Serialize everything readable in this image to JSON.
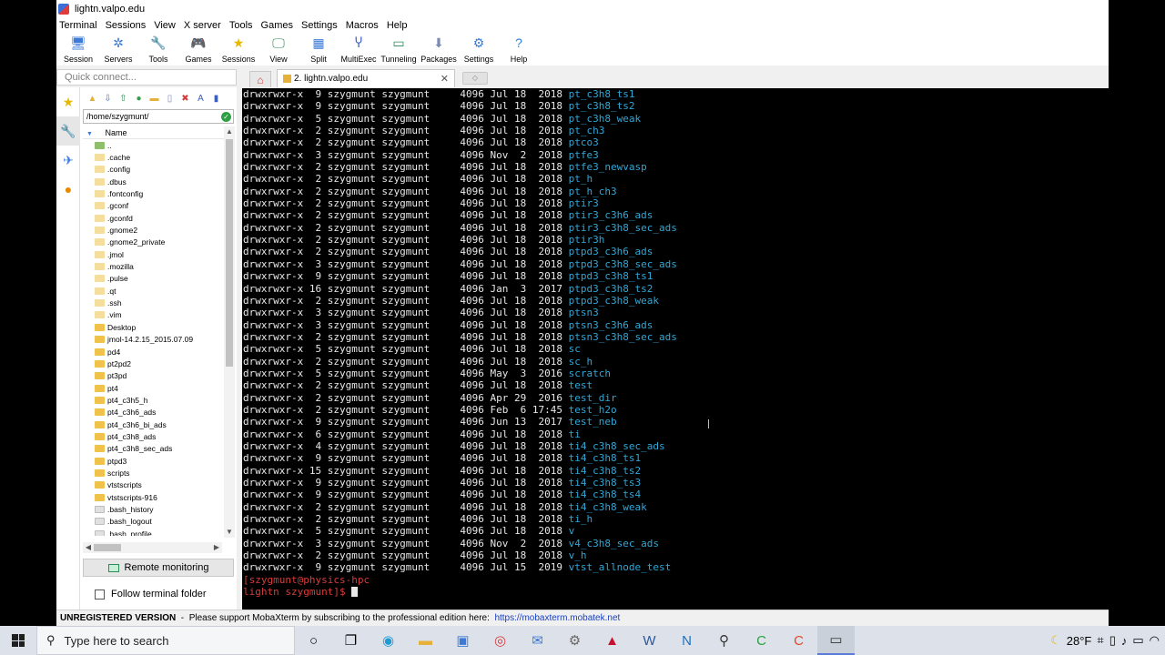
{
  "window": {
    "title": "lightn.valpo.edu"
  },
  "menu": [
    "Terminal",
    "Sessions",
    "View",
    "X server",
    "Tools",
    "Games",
    "Settings",
    "Macros",
    "Help"
  ],
  "toolbar": [
    {
      "label": "Session",
      "icon": "session-icon",
      "glyph": "🖥",
      "color": "#3b7ad8"
    },
    {
      "label": "Servers",
      "icon": "servers-icon",
      "glyph": "✲",
      "color": "#3b7ad8"
    },
    {
      "label": "Tools",
      "icon": "tools-icon",
      "glyph": "🔧",
      "color": "#d83b3b"
    },
    {
      "label": "Games",
      "icon": "games-icon",
      "glyph": "🎮",
      "color": "#555555"
    },
    {
      "label": "Sessions",
      "icon": "star-icon",
      "glyph": "★",
      "color": "#e6b800"
    },
    {
      "label": "View",
      "icon": "view-icon",
      "glyph": "🖵",
      "color": "#2e8b57"
    },
    {
      "label": "Split",
      "icon": "split-icon",
      "glyph": "▦",
      "color": "#3b7ad8"
    },
    {
      "label": "MultiExec",
      "icon": "multiexec-icon",
      "glyph": "Ⴤ",
      "color": "#3b5fbf"
    },
    {
      "label": "Tunneling",
      "icon": "tunneling-icon",
      "glyph": "▭",
      "color": "#2e8b57"
    },
    {
      "label": "Packages",
      "icon": "packages-icon",
      "glyph": "⬇",
      "color": "#7a8ab0"
    },
    {
      "label": "Settings",
      "icon": "gear-icon",
      "glyph": "⚙",
      "color": "#3b7ad8"
    },
    {
      "label": "Help",
      "icon": "help-icon",
      "glyph": "?",
      "color": "#2a7de1"
    }
  ],
  "quick_connect": {
    "placeholder": "Quick connect..."
  },
  "tabs": {
    "session_label": "2. lightn.valpo.edu"
  },
  "panel": {
    "path": "/home/szygmunt/",
    "column_header": "Name",
    "entries": [
      {
        "name": "..",
        "kind": "up"
      },
      {
        "name": ".cache",
        "kind": "hidden"
      },
      {
        "name": ".config",
        "kind": "hidden"
      },
      {
        "name": ".dbus",
        "kind": "hidden"
      },
      {
        "name": ".fontconfig",
        "kind": "hidden"
      },
      {
        "name": ".gconf",
        "kind": "hidden"
      },
      {
        "name": ".gconfd",
        "kind": "hidden"
      },
      {
        "name": ".gnome2",
        "kind": "hidden"
      },
      {
        "name": ".gnome2_private",
        "kind": "hidden"
      },
      {
        "name": ".jmol",
        "kind": "hidden"
      },
      {
        "name": ".mozilla",
        "kind": "hidden"
      },
      {
        "name": ".pulse",
        "kind": "hidden"
      },
      {
        "name": ".qt",
        "kind": "hidden"
      },
      {
        "name": ".ssh",
        "kind": "hidden"
      },
      {
        "name": ".vim",
        "kind": "hidden"
      },
      {
        "name": "Desktop",
        "kind": "dir"
      },
      {
        "name": "jmol-14.2.15_2015.07.09",
        "kind": "dir"
      },
      {
        "name": "pd4",
        "kind": "dir"
      },
      {
        "name": "pt2pd2",
        "kind": "dir"
      },
      {
        "name": "pt3pd",
        "kind": "dir"
      },
      {
        "name": "pt4",
        "kind": "dir"
      },
      {
        "name": "pt4_c3h5_h",
        "kind": "dir"
      },
      {
        "name": "pt4_c3h6_ads",
        "kind": "dir"
      },
      {
        "name": "pt4_c3h6_bi_ads",
        "kind": "dir"
      },
      {
        "name": "pt4_c3h8_ads",
        "kind": "dir"
      },
      {
        "name": "pt4_c3h8_sec_ads",
        "kind": "dir"
      },
      {
        "name": "ptpd3",
        "kind": "dir"
      },
      {
        "name": "scripts",
        "kind": "dir"
      },
      {
        "name": "vtstscripts",
        "kind": "dir"
      },
      {
        "name": "vtstscripts-916",
        "kind": "dir"
      },
      {
        "name": ".bash_history",
        "kind": "file"
      },
      {
        "name": ".bash_logout",
        "kind": "file"
      },
      {
        "name": ".bash_profile",
        "kind": "file"
      }
    ],
    "remote_monitoring_label": "Remote monitoring",
    "follow_folder_label": "Follow terminal folder"
  },
  "terminal": {
    "lines": [
      {
        "perm": "drwxrwxr-x",
        "links": "9",
        "owner": "szygmunt",
        "group": "szygmunt",
        "size": "4096",
        "date": "Jul 18  2018",
        "name": "pt_c3h8_ts1"
      },
      {
        "perm": "drwxrwxr-x",
        "links": "9",
        "owner": "szygmunt",
        "group": "szygmunt",
        "size": "4096",
        "date": "Jul 18  2018",
        "name": "pt_c3h8_ts2"
      },
      {
        "perm": "drwxrwxr-x",
        "links": "5",
        "owner": "szygmunt",
        "group": "szygmunt",
        "size": "4096",
        "date": "Jul 18  2018",
        "name": "pt_c3h8_weak"
      },
      {
        "perm": "drwxrwxr-x",
        "links": "2",
        "owner": "szygmunt",
        "group": "szygmunt",
        "size": "4096",
        "date": "Jul 18  2018",
        "name": "pt_ch3"
      },
      {
        "perm": "drwxrwxr-x",
        "links": "2",
        "owner": "szygmunt",
        "group": "szygmunt",
        "size": "4096",
        "date": "Jul 18  2018",
        "name": "ptco3"
      },
      {
        "perm": "drwxrwxr-x",
        "links": "3",
        "owner": "szygmunt",
        "group": "szygmunt",
        "size": "4096",
        "date": "Nov  2  2018",
        "name": "ptfe3"
      },
      {
        "perm": "drwxrwxr-x",
        "links": "2",
        "owner": "szygmunt",
        "group": "szygmunt",
        "size": "4096",
        "date": "Jul 18  2018",
        "name": "ptfe3_newvasp"
      },
      {
        "perm": "drwxrwxr-x",
        "links": "2",
        "owner": "szygmunt",
        "group": "szygmunt",
        "size": "4096",
        "date": "Jul 18  2018",
        "name": "pt_h"
      },
      {
        "perm": "drwxrwxr-x",
        "links": "2",
        "owner": "szygmunt",
        "group": "szygmunt",
        "size": "4096",
        "date": "Jul 18  2018",
        "name": "pt_h_ch3"
      },
      {
        "perm": "drwxrwxr-x",
        "links": "2",
        "owner": "szygmunt",
        "group": "szygmunt",
        "size": "4096",
        "date": "Jul 18  2018",
        "name": "ptir3"
      },
      {
        "perm": "drwxrwxr-x",
        "links": "2",
        "owner": "szygmunt",
        "group": "szygmunt",
        "size": "4096",
        "date": "Jul 18  2018",
        "name": "ptir3_c3h6_ads"
      },
      {
        "perm": "drwxrwxr-x",
        "links": "2",
        "owner": "szygmunt",
        "group": "szygmunt",
        "size": "4096",
        "date": "Jul 18  2018",
        "name": "ptir3_c3h8_sec_ads"
      },
      {
        "perm": "drwxrwxr-x",
        "links": "2",
        "owner": "szygmunt",
        "group": "szygmunt",
        "size": "4096",
        "date": "Jul 18  2018",
        "name": "ptir3h"
      },
      {
        "perm": "drwxrwxr-x",
        "links": "2",
        "owner": "szygmunt",
        "group": "szygmunt",
        "size": "4096",
        "date": "Jul 18  2018",
        "name": "ptpd3_c3h6_ads"
      },
      {
        "perm": "drwxrwxr-x",
        "links": "3",
        "owner": "szygmunt",
        "group": "szygmunt",
        "size": "4096",
        "date": "Jul 18  2018",
        "name": "ptpd3_c3h8_sec_ads"
      },
      {
        "perm": "drwxrwxr-x",
        "links": "9",
        "owner": "szygmunt",
        "group": "szygmunt",
        "size": "4096",
        "date": "Jul 18  2018",
        "name": "ptpd3_c3h8_ts1"
      },
      {
        "perm": "drwxrwxr-x",
        "links": "16",
        "owner": "szygmunt",
        "group": "szygmunt",
        "size": "4096",
        "date": "Jan  3  2017",
        "name": "ptpd3_c3h8_ts2"
      },
      {
        "perm": "drwxrwxr-x",
        "links": "2",
        "owner": "szygmunt",
        "group": "szygmunt",
        "size": "4096",
        "date": "Jul 18  2018",
        "name": "ptpd3_c3h8_weak"
      },
      {
        "perm": "drwxrwxr-x",
        "links": "3",
        "owner": "szygmunt",
        "group": "szygmunt",
        "size": "4096",
        "date": "Jul 18  2018",
        "name": "ptsn3"
      },
      {
        "perm": "drwxrwxr-x",
        "links": "3",
        "owner": "szygmunt",
        "group": "szygmunt",
        "size": "4096",
        "date": "Jul 18  2018",
        "name": "ptsn3_c3h6_ads"
      },
      {
        "perm": "drwxrwxr-x",
        "links": "2",
        "owner": "szygmunt",
        "group": "szygmunt",
        "size": "4096",
        "date": "Jul 18  2018",
        "name": "ptsn3_c3h8_sec_ads"
      },
      {
        "perm": "drwxrwxr-x",
        "links": "5",
        "owner": "szygmunt",
        "group": "szygmunt",
        "size": "4096",
        "date": "Jul 18  2018",
        "name": "sc"
      },
      {
        "perm": "drwxrwxr-x",
        "links": "2",
        "owner": "szygmunt",
        "group": "szygmunt",
        "size": "4096",
        "date": "Jul 18  2018",
        "name": "sc_h"
      },
      {
        "perm": "drwxrwxr-x",
        "links": "5",
        "owner": "szygmunt",
        "group": "szygmunt",
        "size": "4096",
        "date": "May  3  2016",
        "name": "scratch"
      },
      {
        "perm": "drwxrwxr-x",
        "links": "2",
        "owner": "szygmunt",
        "group": "szygmunt",
        "size": "4096",
        "date": "Jul 18  2018",
        "name": "test"
      },
      {
        "perm": "drwxrwxr-x",
        "links": "2",
        "owner": "szygmunt",
        "group": "szygmunt",
        "size": "4096",
        "date": "Apr 29  2016",
        "name": "test_dir"
      },
      {
        "perm": "drwxrwxr-x",
        "links": "2",
        "owner": "szygmunt",
        "group": "szygmunt",
        "size": "4096",
        "date": "Feb  6 17:45",
        "name": "test_h2o"
      },
      {
        "perm": "drwxrwxr-x",
        "links": "9",
        "owner": "szygmunt",
        "group": "szygmunt",
        "size": "4096",
        "date": "Jun 13  2017",
        "name": "test_neb"
      },
      {
        "perm": "drwxrwxr-x",
        "links": "6",
        "owner": "szygmunt",
        "group": "szygmunt",
        "size": "4096",
        "date": "Jul 18  2018",
        "name": "ti"
      },
      {
        "perm": "drwxrwxr-x",
        "links": "4",
        "owner": "szygmunt",
        "group": "szygmunt",
        "size": "4096",
        "date": "Jul 18  2018",
        "name": "ti4_c3h8_sec_ads"
      },
      {
        "perm": "drwxrwxr-x",
        "links": "9",
        "owner": "szygmunt",
        "group": "szygmunt",
        "size": "4096",
        "date": "Jul 18  2018",
        "name": "ti4_c3h8_ts1"
      },
      {
        "perm": "drwxrwxr-x",
        "links": "15",
        "owner": "szygmunt",
        "group": "szygmunt",
        "size": "4096",
        "date": "Jul 18  2018",
        "name": "ti4_c3h8_ts2"
      },
      {
        "perm": "drwxrwxr-x",
        "links": "9",
        "owner": "szygmunt",
        "group": "szygmunt",
        "size": "4096",
        "date": "Jul 18  2018",
        "name": "ti4_c3h8_ts3"
      },
      {
        "perm": "drwxrwxr-x",
        "links": "9",
        "owner": "szygmunt",
        "group": "szygmunt",
        "size": "4096",
        "date": "Jul 18  2018",
        "name": "ti4_c3h8_ts4"
      },
      {
        "perm": "drwxrwxr-x",
        "links": "2",
        "owner": "szygmunt",
        "group": "szygmunt",
        "size": "4096",
        "date": "Jul 18  2018",
        "name": "ti4_c3h8_weak"
      },
      {
        "perm": "drwxrwxr-x",
        "links": "2",
        "owner": "szygmunt",
        "group": "szygmunt",
        "size": "4096",
        "date": "Jul 18  2018",
        "name": "ti_h"
      },
      {
        "perm": "drwxrwxr-x",
        "links": "5",
        "owner": "szygmunt",
        "group": "szygmunt",
        "size": "4096",
        "date": "Jul 18  2018",
        "name": "v"
      },
      {
        "perm": "drwxrwxr-x",
        "links": "3",
        "owner": "szygmunt",
        "group": "szygmunt",
        "size": "4096",
        "date": "Nov  2  2018",
        "name": "v4_c3h8_sec_ads"
      },
      {
        "perm": "drwxrwxr-x",
        "links": "2",
        "owner": "szygmunt",
        "group": "szygmunt",
        "size": "4096",
        "date": "Jul 18  2018",
        "name": "v_h"
      },
      {
        "perm": "drwxrwxr-x",
        "links": "9",
        "owner": "szygmunt",
        "group": "szygmunt",
        "size": "4096",
        "date": "Jul 15  2019",
        "name": "vtst_allnode_test"
      }
    ],
    "prompt_line1": "[szygmunt@physics-hpc",
    "prompt_line2": "lightn szygmunt]$ "
  },
  "statusbar": {
    "edition": "UNREGISTERED VERSION",
    "message": "  -  Please support MobaXterm by subscribing to the professional edition here:  ",
    "link": "https://mobaxterm.mobatek.net"
  },
  "taskbar": {
    "search_placeholder": "Type here to search",
    "temperature": "28°F"
  },
  "colors": {
    "dir_name": "#2fa8d8",
    "prompt": "#d83b3b",
    "terminal_bg": "#000000"
  }
}
